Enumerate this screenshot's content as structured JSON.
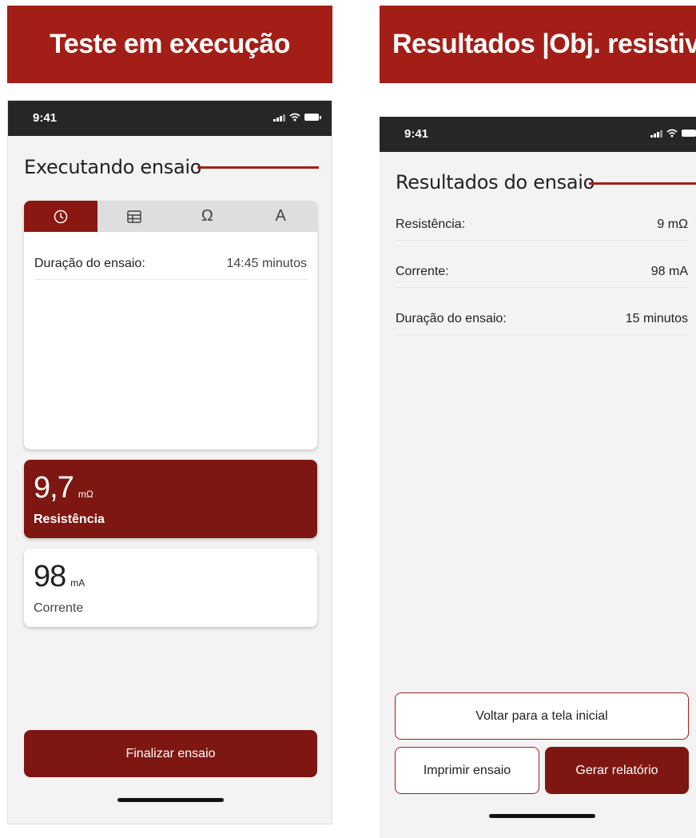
{
  "banners": {
    "left": "Teste em execução",
    "right": "Resultados |Obj. resistivo"
  },
  "left_phone": {
    "status_time": "9:41",
    "title": "Executando ensaio",
    "tabs": [
      {
        "icon": "clock-icon",
        "glyph": "",
        "active": true
      },
      {
        "icon": "table-icon",
        "glyph": "",
        "active": false
      },
      {
        "icon": "ohm-icon",
        "glyph": "Ω",
        "active": false
      },
      {
        "icon": "ampere-icon",
        "glyph": "A",
        "active": false
      }
    ],
    "duration_label": "Duração do ensaio:",
    "duration_value": "14:45 minutos",
    "resistance": {
      "value": "9,7",
      "unit": "mΩ",
      "label": "Resistência"
    },
    "current": {
      "value": "98",
      "unit": "mA",
      "label": "Corrente"
    },
    "finish_button": "Finalizar ensaio"
  },
  "right_phone": {
    "status_time": "9:41",
    "title": "Resultados do ensaio",
    "rows": [
      {
        "label": "Resistência:",
        "value": "9 mΩ"
      },
      {
        "label": "Corrente:",
        "value": "98 mA"
      },
      {
        "label": "Duração do ensaio:",
        "value": "15 minutos"
      }
    ],
    "back_button": "Voltar para a tela inicial",
    "print_button": "Imprimir ensaio",
    "report_button": "Gerar relatório"
  },
  "colors": {
    "brand_red": "#a31e17",
    "dark_red": "#7e1711",
    "status_bar": "#262626",
    "screen_bg": "#f3f3f3"
  }
}
